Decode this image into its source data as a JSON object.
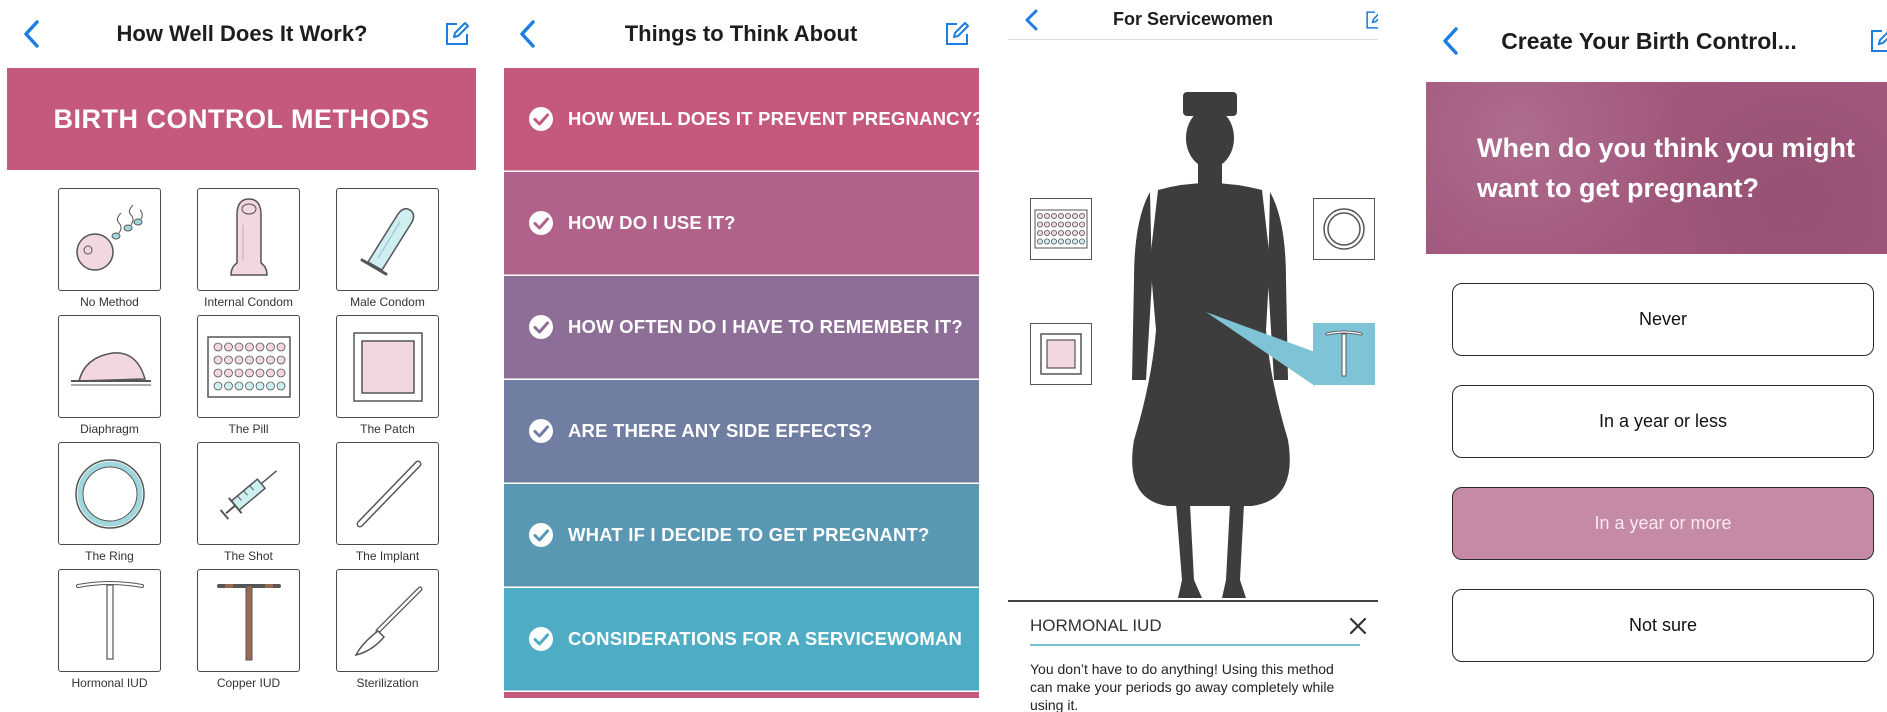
{
  "screen1": {
    "title": "How Well Does It Work?",
    "banner": "BIRTH CONTROL METHODS",
    "methods": [
      {
        "label": "No Method",
        "icon": "sperm-egg-icon"
      },
      {
        "label": "Internal Condom",
        "icon": "internal-condom-icon"
      },
      {
        "label": "Male Condom",
        "icon": "male-condom-icon"
      },
      {
        "label": "Diaphragm",
        "icon": "diaphragm-icon"
      },
      {
        "label": "The Pill",
        "icon": "pill-pack-icon"
      },
      {
        "label": "The Patch",
        "icon": "patch-icon"
      },
      {
        "label": "The Ring",
        "icon": "ring-icon"
      },
      {
        "label": "The Shot",
        "icon": "syringe-icon"
      },
      {
        "label": "The Implant",
        "icon": "implant-icon"
      },
      {
        "label": "Hormonal IUD",
        "icon": "hormonal-iud-icon"
      },
      {
        "label": "Copper IUD",
        "icon": "copper-iud-icon"
      },
      {
        "label": "Sterilization",
        "icon": "scalpel-icon"
      }
    ]
  },
  "screen2": {
    "title": "Things to Think About",
    "topics": [
      {
        "label": "HOW WELL DOES IT PREVENT PREGNANCY?",
        "color": "#c5587d"
      },
      {
        "label": "HOW DO I USE IT?",
        "color": "#b0628a"
      },
      {
        "label": "HOW OFTEN DO I HAVE TO REMEMBER IT?",
        "color": "#8c6e97"
      },
      {
        "label": "ARE THERE ANY SIDE EFFECTS?",
        "color": "#707ea1"
      },
      {
        "label": "WHAT IF I DECIDE TO GET PREGNANT?",
        "color": "#5a97b2"
      },
      {
        "label": "CONSIDERATIONS FOR A SERVICEWOMAN",
        "color": "#4eadc4"
      }
    ]
  },
  "screen3": {
    "title": "For Servicewomen",
    "panel_title": "HORMONAL IUD",
    "panel_text": "You don’t have to do anything! Using this method can make your periods go away completely while using it.",
    "highlight_color": "#7fc4d6"
  },
  "screen4": {
    "title": "Create Your Birth Control...",
    "question": "When do you think you might want to get pregnant?",
    "answers": [
      {
        "label": "Never",
        "selected": false
      },
      {
        "label": "In a year or less",
        "selected": false
      },
      {
        "label": "In a year or more",
        "selected": true
      },
      {
        "label": "Not sure",
        "selected": false
      }
    ]
  },
  "colors": {
    "accent_blue": "#1d7de0",
    "brand_pink": "#c5587d",
    "silhouette": "#3d3d3d"
  }
}
